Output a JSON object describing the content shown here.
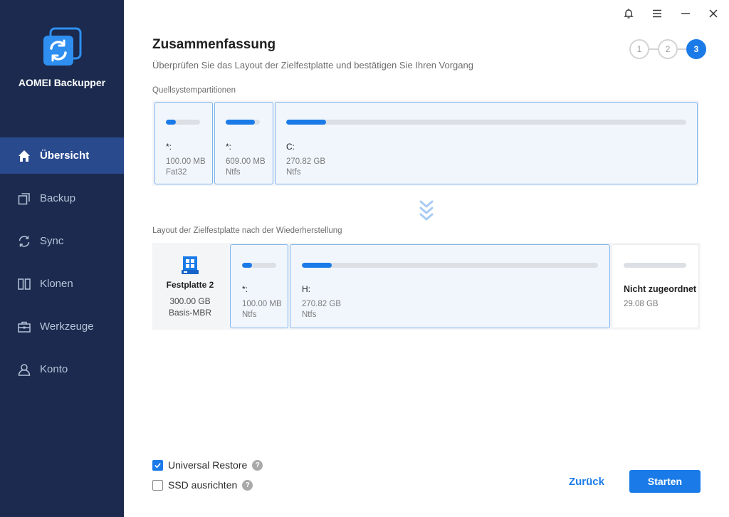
{
  "app": {
    "name": "AOMEI Backupper"
  },
  "nav": [
    {
      "label": "Übersicht",
      "icon": "home-icon",
      "active": true
    },
    {
      "label": "Backup",
      "icon": "backup-icon"
    },
    {
      "label": "Sync",
      "icon": "sync-icon"
    },
    {
      "label": "Klonen",
      "icon": "clone-icon"
    },
    {
      "label": "Werkzeuge",
      "icon": "tools-icon"
    },
    {
      "label": "Konto",
      "icon": "account-icon"
    }
  ],
  "header": {
    "title": "Zusammenfassung",
    "subtitle": "Überprüfen Sie das Layout der Zielfestplatte und bestätigen Sie Ihren Vorgang",
    "steps": [
      "1",
      "2",
      "3"
    ],
    "active_step": 3
  },
  "source": {
    "label": "Quellsystempartitionen",
    "partitions": [
      {
        "name": "*:",
        "size": "100.00 MB",
        "fs": "Fat32",
        "used_fraction": 0.3
      },
      {
        "name": "*:",
        "size": "609.00 MB",
        "fs": "Ntfs",
        "used_fraction": 0.85
      },
      {
        "name": "C:",
        "size": "270.82 GB",
        "fs": "Ntfs",
        "used_fraction": 0.1
      }
    ]
  },
  "target": {
    "label": "Layout der Zielfestplatte nach der Wiederherstellung",
    "disk": {
      "name": "Festplatte 2",
      "size": "300.00 GB",
      "type": "Basis-MBR"
    },
    "partitions": [
      {
        "name": "*:",
        "size": "100.00 MB",
        "fs": "Ntfs",
        "used_fraction": 0.3
      },
      {
        "name": "H:",
        "size": "270.82 GB",
        "fs": "Ntfs",
        "used_fraction": 0.1
      },
      {
        "name": "Nicht zugeordnet",
        "size": "29.08 GB",
        "fs": "",
        "used_fraction": 0
      }
    ]
  },
  "options": {
    "universal_restore": {
      "label": "Universal Restore",
      "checked": true
    },
    "ssd_align": {
      "label": "SSD ausrichten",
      "checked": false
    },
    "help": "?"
  },
  "buttons": {
    "back": "Zurück",
    "start": "Starten"
  },
  "colors": {
    "sidebar": "#1b2a4e",
    "accent": "#1a7be8"
  }
}
